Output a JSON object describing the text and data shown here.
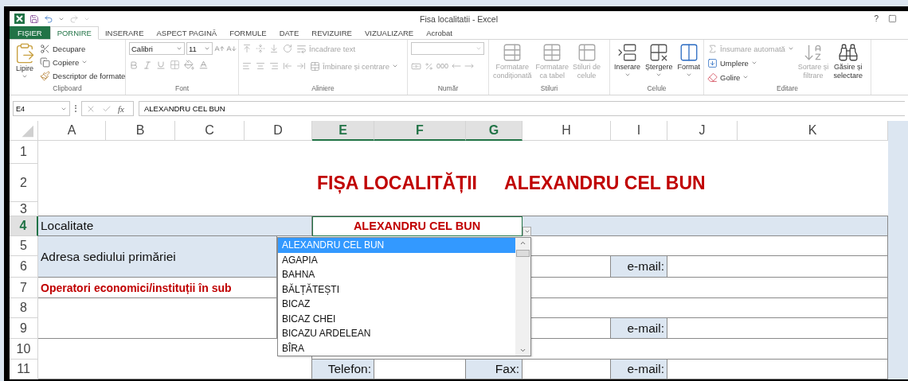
{
  "window": {
    "title": "Fisa localitatii - Excel",
    "help": "?"
  },
  "tabs": [
    {
      "label": "FIȘIER",
      "kind": "file",
      "selected": false
    },
    {
      "label": "PORNIRE",
      "kind": "tab",
      "selected": true
    },
    {
      "label": "INSERARE",
      "kind": "tab",
      "selected": false
    },
    {
      "label": "ASPECT PAGINĂ",
      "kind": "tab",
      "selected": false
    },
    {
      "label": "FORMULE",
      "kind": "tab",
      "selected": false
    },
    {
      "label": "DATE",
      "kind": "tab",
      "selected": false
    },
    {
      "label": "REVIZUIRE",
      "kind": "tab",
      "selected": false
    },
    {
      "label": "VIZUALIZARE",
      "kind": "tab",
      "selected": false
    },
    {
      "label": "Acrobat",
      "kind": "tab",
      "selected": false
    }
  ],
  "ribbon": {
    "groups": [
      {
        "kind": "clipboard",
        "label": "Clipboard",
        "items": [
          {
            "label": "Lipire",
            "disabled": false
          },
          {
            "label": "Decupare",
            "disabled": false
          },
          {
            "label": "Copiere",
            "disabled": false
          },
          {
            "label": "Descriptor de formate",
            "disabled": false
          }
        ]
      },
      {
        "kind": "font",
        "label": "Font",
        "font_name": "Calibri",
        "font_size": "11"
      },
      {
        "kind": "alignment",
        "label": "Aliniere",
        "items": [
          {
            "label": "Încadrare text",
            "disabled": true
          },
          {
            "label": "Îmbinare și centrare",
            "disabled": true
          }
        ]
      },
      {
        "kind": "number",
        "label": "Număr",
        "items": [
          {
            "label": "000",
            "disabled": true
          }
        ]
      },
      {
        "kind": "styles",
        "label": "Stiluri",
        "items": [
          {
            "lines": [
              "Formatare",
              "condiționată"
            ],
            "disabled": true
          },
          {
            "lines": [
              "Formatare",
              "ca tabel"
            ],
            "disabled": true
          },
          {
            "lines": [
              "Stiluri de",
              "celule"
            ],
            "disabled": true
          }
        ]
      },
      {
        "kind": "cells",
        "label": "Celule",
        "items": [
          {
            "lines": [
              "Inserare"
            ],
            "disabled": false
          },
          {
            "lines": [
              "Ștergere"
            ],
            "disabled": false
          },
          {
            "lines": [
              "Format"
            ],
            "disabled": false
          }
        ]
      },
      {
        "kind": "editing",
        "label": "Editare",
        "items": [
          {
            "label": "Însumare automată",
            "disabled": true
          },
          {
            "label": "Umplere",
            "disabled": false
          },
          {
            "label": "Golire",
            "disabled": false
          },
          {
            "lines": [
              "Sortare și",
              "filtrare"
            ],
            "disabled": true
          },
          {
            "lines": [
              "Găsire și",
              "selectare"
            ],
            "disabled": false
          }
        ]
      }
    ]
  },
  "formula_bar": {
    "name_box": "E4",
    "function_label": "fx",
    "content": "ALEXANDRU CEL BUN"
  },
  "sheet": {
    "columns": [
      {
        "label": "A",
        "selected": false
      },
      {
        "label": "B",
        "selected": false
      },
      {
        "label": "C",
        "selected": false
      },
      {
        "label": "D",
        "selected": false
      },
      {
        "label": "E",
        "selected": true
      },
      {
        "label": "F",
        "selected": true
      },
      {
        "label": "G",
        "selected": true
      },
      {
        "label": "H",
        "selected": false
      },
      {
        "label": "I",
        "selected": false
      },
      {
        "label": "J",
        "selected": false
      },
      {
        "label": "K",
        "selected": false
      }
    ],
    "rows": [
      {
        "label": "1",
        "selected": false
      },
      {
        "label": "2",
        "selected": false
      },
      {
        "label": "3",
        "selected": false
      },
      {
        "label": "4",
        "selected": true
      },
      {
        "label": "5",
        "selected": false
      },
      {
        "label": "6",
        "selected": false
      },
      {
        "label": "7",
        "selected": false
      },
      {
        "label": "8",
        "selected": false
      },
      {
        "label": "9",
        "selected": false
      },
      {
        "label": "10",
        "selected": false
      },
      {
        "label": "11",
        "selected": false
      }
    ],
    "title": [
      "FIȘA LOCALITĂȚII",
      "ALEXANDRU CEL BUN"
    ],
    "cells": [
      {
        "text": "Localitate",
        "kind": "label",
        "selected": false
      },
      {
        "text": "ALEXANDRU CEL BUN",
        "kind": "value",
        "selected": true
      },
      {
        "text": "Adresa sediului primăriei",
        "kind": "label",
        "selected": false
      },
      {
        "text": "e-mail:",
        "kind": "field",
        "selected": false
      },
      {
        "text": "Operatori economici/instituții în sub",
        "kind": "heading",
        "selected": false
      },
      {
        "text": "e-mail:",
        "kind": "field",
        "selected": false
      },
      {
        "text": "Telefon:",
        "kind": "field",
        "selected": false
      },
      {
        "text": "Fax:",
        "kind": "field",
        "selected": false
      },
      {
        "text": "e-mail:",
        "kind": "field",
        "selected": false
      }
    ]
  },
  "dropdown": {
    "items": [
      {
        "label": "ALEXANDRU CEL BUN",
        "selected": true
      },
      {
        "label": "AGAPIA",
        "selected": false
      },
      {
        "label": "BAHNA",
        "selected": false
      },
      {
        "label": "BĂLȚĂTEȘTI",
        "selected": false
      },
      {
        "label": "BICAZ",
        "selected": false
      },
      {
        "label": "BICAZ CHEI",
        "selected": false
      },
      {
        "label": "BICAZU ARDELEAN",
        "selected": false
      },
      {
        "label": "BÎRA",
        "selected": false
      }
    ]
  }
}
